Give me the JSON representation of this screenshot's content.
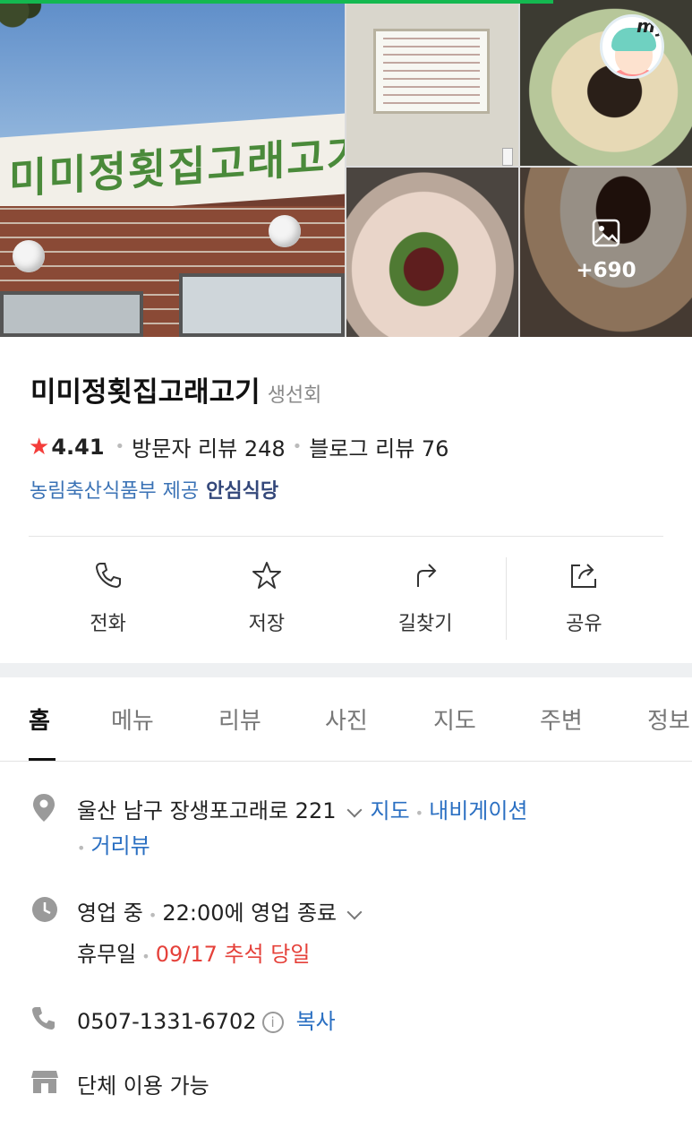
{
  "photos": {
    "main_sign_text": "미미정횟집고래고기",
    "more_count": "+690"
  },
  "avatar": {
    "badge": "my"
  },
  "place": {
    "name": "미미정횟집고래고기",
    "category": "생선회",
    "rating": "4.41",
    "visitor_reviews": "방문자 리뷰 248",
    "blog_reviews": "블로그 리뷰 76",
    "cert_source": "농림축산식품부 제공",
    "cert_badge": "안심식당"
  },
  "actions": [
    {
      "label": "전화",
      "icon": "phone-icon"
    },
    {
      "label": "저장",
      "icon": "star-icon"
    },
    {
      "label": "길찾기",
      "icon": "directions-icon"
    },
    {
      "label": "공유",
      "icon": "share-icon"
    }
  ],
  "tabs": [
    "홈",
    "메뉴",
    "리뷰",
    "사진",
    "지도",
    "주변",
    "정보"
  ],
  "active_tab": "홈",
  "details": {
    "address": "울산 남구 장생포고래로 221",
    "map_link": "지도",
    "nav_link": "내비게이션",
    "street_view": "거리뷰",
    "status": "영업 중",
    "close_time": "22:00에 영업 종료",
    "holiday_label": "휴무일",
    "holiday_value": "09/17 추석 당일",
    "phone": "0507-1331-6702",
    "copy_label": "복사",
    "group": "단체 이용 가능"
  },
  "colors": {
    "accent_green": "#14b850",
    "link_blue": "#2a6fc2",
    "rating_star": "#f43d3a",
    "holiday_red": "#e5413a"
  }
}
